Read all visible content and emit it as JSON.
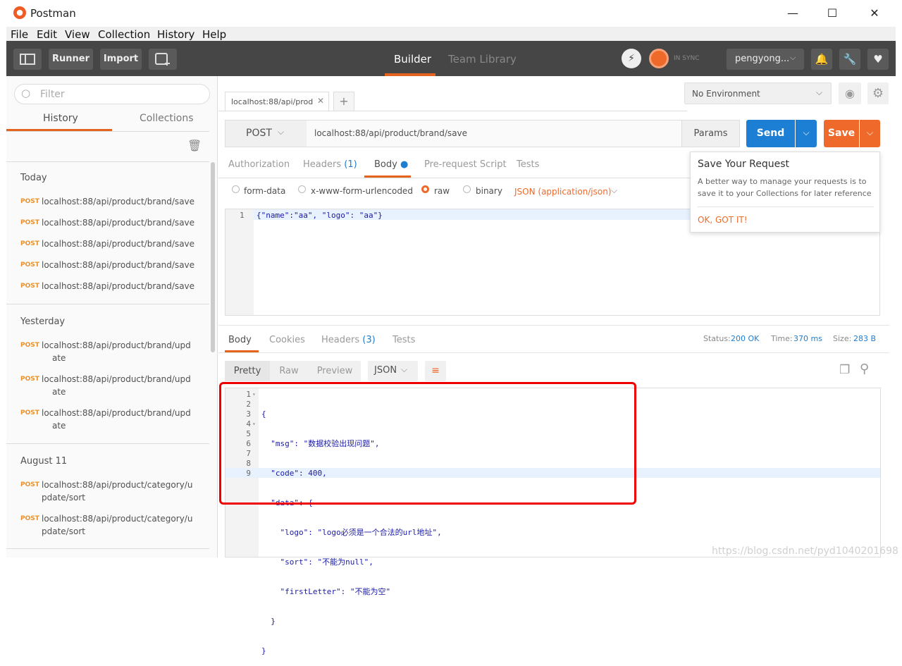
{
  "window": {
    "title": "Postman",
    "min": "—",
    "max": "☐",
    "close": "✕"
  },
  "menu": [
    "File",
    "Edit",
    "View",
    "Collection",
    "History",
    "Help"
  ],
  "toolbar": {
    "runner": "Runner",
    "import": "Import",
    "tabs": {
      "builder": "Builder",
      "team_library": "Team Library"
    },
    "sync": "IN SYNC",
    "user": "pengyong...",
    "colors": {
      "bg": "#464646",
      "active_tab": "#e4631f"
    }
  },
  "sidebar": {
    "filter_placeholder": "Filter",
    "tabs": {
      "history": "History",
      "collections": "Collections"
    },
    "groups": [
      {
        "label": "Today",
        "items": [
          {
            "method": "POST",
            "url": "localhost:88/api/product/brand/save"
          },
          {
            "method": "POST",
            "url": "localhost:88/api/product/brand/save"
          },
          {
            "method": "POST",
            "url": "localhost:88/api/product/brand/save"
          },
          {
            "method": "POST",
            "url": "localhost:88/api/product/brand/save"
          },
          {
            "method": "POST",
            "url": "localhost:88/api/product/brand/save"
          }
        ]
      },
      {
        "label": "Yesterday",
        "items": [
          {
            "method": "POST",
            "url": "localhost:88/api/product/brand/upd",
            "url2": "ate"
          },
          {
            "method": "POST",
            "url": "localhost:88/api/product/brand/upd",
            "url2": "ate"
          },
          {
            "method": "POST",
            "url": "localhost:88/api/product/brand/upd",
            "url2": "ate"
          }
        ]
      },
      {
        "label": "August 11",
        "items": [
          {
            "method": "POST",
            "url": "localhost:88/api/product/category/u",
            "url2": "pdate/sort"
          },
          {
            "method": "POST",
            "url": "localhost:88/api/product/category/u",
            "url2": "pdate/sort"
          }
        ]
      }
    ]
  },
  "request": {
    "tab_label": "localhost:88/api/prod",
    "environment": "No Environment",
    "method": "POST",
    "url": "localhost:88/api/product/brand/save",
    "params": "Params",
    "send": "Send",
    "save": "Save",
    "tabs": {
      "authorization": "Authorization",
      "headers": "Headers",
      "headers_count": "(1)",
      "body": "Body",
      "prerequest": "Pre-request Script",
      "tests": "Tests"
    },
    "body_types": {
      "form_data": "form-data",
      "urlencoded": "x-www-form-urlencoded",
      "raw": "raw",
      "binary": "binary"
    },
    "content_type": "JSON (application/json)",
    "body_line": "1",
    "body_code": "{\"name\":\"aa\", \"logo\": \"aa\"}"
  },
  "popup": {
    "title": "Save Your Request",
    "text": "A better way to manage your requests is to save it to your Collections for later reference",
    "action": "OK, GOT IT!"
  },
  "response": {
    "tabs": {
      "body": "Body",
      "cookies": "Cookies",
      "headers": "Headers",
      "headers_count": "(3)",
      "tests": "Tests"
    },
    "status_label": "Status:",
    "status": "200 OK",
    "time_label": "Time:",
    "time": "370 ms",
    "size_label": "Size:",
    "size": "283 B",
    "view_modes": {
      "pretty": "Pretty",
      "raw": "Raw",
      "preview": "Preview"
    },
    "format": "JSON",
    "lines": [
      {
        "n": "1",
        "text": "{"
      },
      {
        "n": "2",
        "text": "  \"msg\": \"数据校验出现问题\","
      },
      {
        "n": "3",
        "text": "  \"code\": 400,"
      },
      {
        "n": "4",
        "text": "  \"data\": {"
      },
      {
        "n": "5",
        "text": "    \"logo\": \"logo必须是一个合法的url地址\","
      },
      {
        "n": "6",
        "text": "    \"sort\": \"不能为null\","
      },
      {
        "n": "7",
        "text": "    \"firstLetter\": \"不能为空\""
      },
      {
        "n": "8",
        "text": "  }"
      },
      {
        "n": "9",
        "text": "}"
      }
    ]
  },
  "watermark": "https://blog.csdn.net/pyd1040201698"
}
